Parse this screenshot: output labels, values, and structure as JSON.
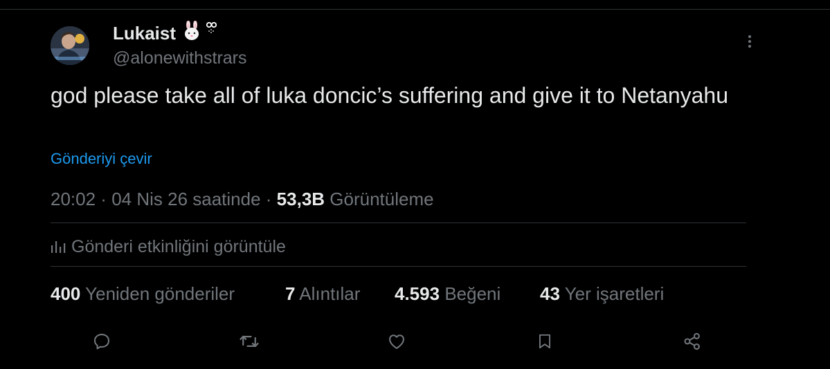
{
  "author": {
    "display_name": "Lukaist",
    "handle": "@alonewithstrars",
    "name_emoji": "rabbit-face-and-sparkle-emoji"
  },
  "tweet": {
    "text": "god please take all of luka doncic’s suffering and give it to Netanyahu",
    "translate_label": "Gönderiyi çevir"
  },
  "meta": {
    "time": "20:02",
    "separator": " · ",
    "date": "04 Nis 26 saatinde",
    "views_count": "53,3B",
    "views_label": "Görüntüleme"
  },
  "analytics": {
    "label": "Gönderi etkinliğini görüntüle"
  },
  "stats": [
    {
      "count": "400",
      "label": "Yeniden gönderiler"
    },
    {
      "count": "7",
      "label": "Alıntılar"
    },
    {
      "count": "4.593",
      "label": "Beğeni"
    },
    {
      "count": "43",
      "label": "Yer işaretleri"
    }
  ],
  "actions": [
    "reply-icon",
    "retweet-icon",
    "like-icon",
    "bookmark-icon",
    "share-icon"
  ],
  "colors": {
    "background": "#000000",
    "primary_text": "#e7e9ea",
    "secondary_text": "#71767b",
    "link": "#1d9bf0",
    "divider": "#2f3336"
  }
}
